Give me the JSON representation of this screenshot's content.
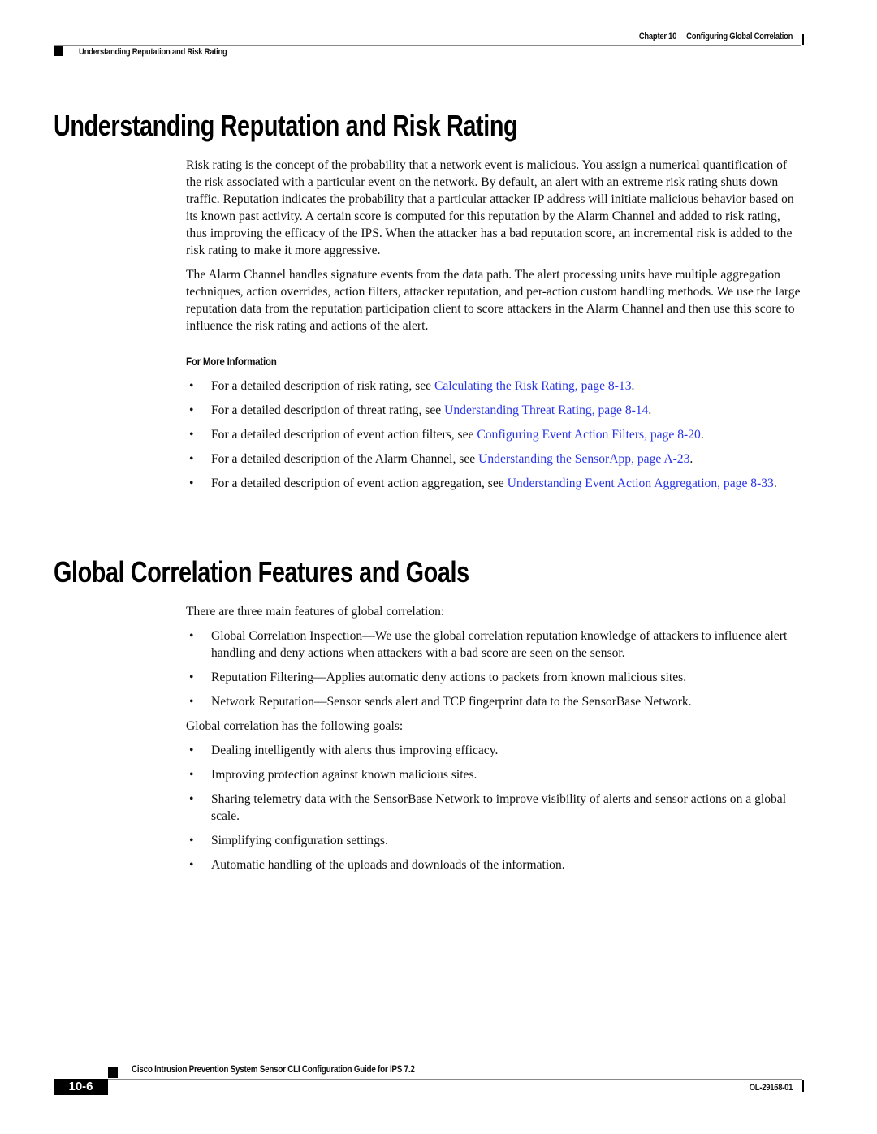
{
  "header": {
    "chapter_number": "Chapter 10",
    "chapter_title": "Configuring Global Correlation",
    "section_title": "Understanding Reputation and Risk Rating"
  },
  "sections": [
    {
      "heading": "Understanding Reputation and Risk Rating",
      "paragraphs": [
        "Risk rating is the concept of the probability that a network event is malicious. You assign a numerical quantification of the risk associated with a particular event on the network. By default, an alert with an extreme risk rating shuts down traffic. Reputation indicates the probability that a particular attacker IP address will initiate malicious behavior based on its known past activity. A certain score is computed for this reputation by the Alarm Channel and added to risk rating, thus improving the efficacy of the IPS. When the attacker has a bad reputation score, an incremental risk is added to the risk rating to make it more aggressive.",
        "The Alarm Channel handles signature events from the data path. The alert processing units have multiple aggregation techniques, action overrides, action filters, attacker reputation, and per-action custom handling methods. We use the large reputation data from the reputation participation client to score attackers in the Alarm Channel and then use this score to influence the risk rating and actions of the alert."
      ],
      "subheading": "For More Information",
      "references": [
        {
          "prefix": "For a detailed description of risk rating, see ",
          "link": "Calculating the Risk Rating, page 8-13",
          "suffix": "."
        },
        {
          "prefix": "For a detailed description of threat rating, see ",
          "link": "Understanding Threat Rating, page 8-14",
          "suffix": "."
        },
        {
          "prefix": "For a detailed description of event action filters, see ",
          "link": "Configuring Event Action Filters, page 8-20",
          "suffix": "."
        },
        {
          "prefix": "For a detailed description of the Alarm Channel, see ",
          "link": "Understanding the SensorApp, page A-23",
          "suffix": "."
        },
        {
          "prefix": "For a detailed description of event action aggregation, see ",
          "link": "Understanding Event Action Aggregation, page 8-33",
          "suffix": "."
        }
      ]
    },
    {
      "heading": "Global Correlation Features and Goals",
      "features_intro": "There are three main features of global correlation:",
      "features": [
        "Global Correlation Inspection—We use the global correlation reputation knowledge of attackers to influence alert handling and deny actions when attackers with a bad score are seen on the sensor.",
        "Reputation Filtering—Applies automatic deny actions to packets from known malicious sites.",
        "Network Reputation—Sensor sends alert and TCP fingerprint data to the SensorBase Network."
      ],
      "goals_intro": "Global correlation has the following goals:",
      "goals": [
        "Dealing intelligently with alerts thus improving efficacy.",
        "Improving protection against known malicious sites.",
        "Sharing telemetry data with the SensorBase Network to improve visibility of alerts and sensor actions on a global scale.",
        "Simplifying configuration settings.",
        "Automatic handling of the uploads and downloads of the information."
      ]
    }
  ],
  "footer": {
    "book_title": "Cisco Intrusion Prevention System Sensor CLI Configuration Guide for IPS 7.2",
    "page_number": "10-6",
    "doc_number": "OL-29168-01"
  },
  "bullet_glyph": "•",
  "colors": {
    "link": "#2a35e8",
    "text": "#111111"
  }
}
